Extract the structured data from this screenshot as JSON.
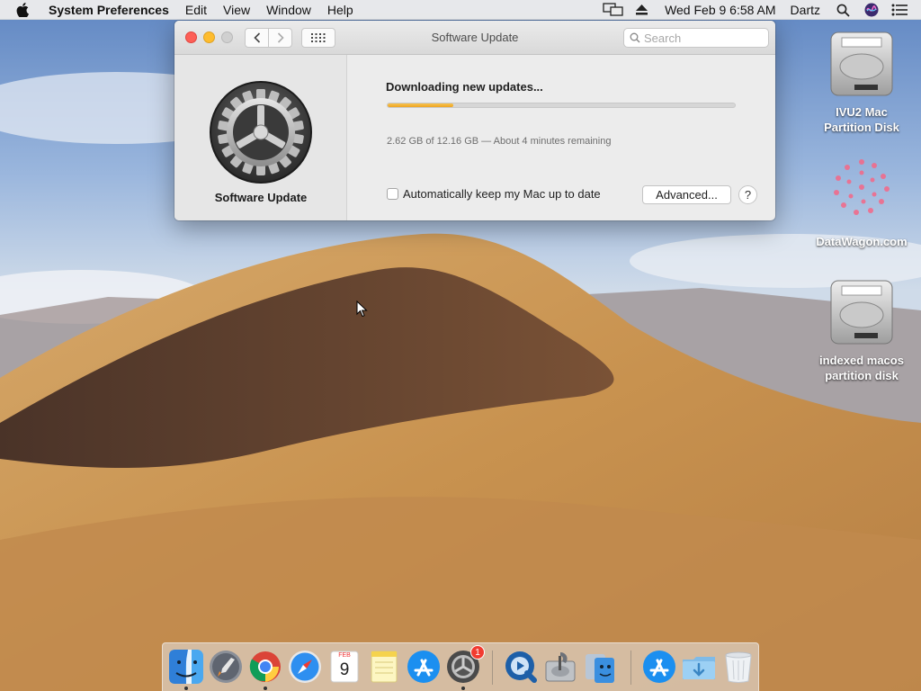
{
  "menubar": {
    "app_name": "System Preferences",
    "menus": [
      "Edit",
      "View",
      "Window",
      "Help"
    ],
    "clock": "Wed Feb 9  6:58 AM",
    "user": "Dartz"
  },
  "window": {
    "title": "Software Update",
    "search_placeholder": "Search",
    "sidebar_label": "Software Update",
    "status": "Downloading new updates...",
    "progress": 0.19,
    "progress_text": "2.62 GB of 12.16 GB — About 4 minutes remaining",
    "auto_update_label": "Automatically keep my Mac up to date",
    "auto_update_checked": false,
    "advanced_label": "Advanced...",
    "help_label": "?"
  },
  "desktop_icons": [
    {
      "label": "IVU2 Mac\nPartition Disk",
      "icon": "hard-disk-icon"
    },
    {
      "label": "DataWagon.com",
      "icon": "datawagon-logo-icon"
    },
    {
      "label": "indexed macos\npartition disk",
      "icon": "hard-disk-icon"
    }
  ],
  "dock": {
    "items": [
      {
        "name": "finder",
        "icon": "finder-icon",
        "running": true
      },
      {
        "name": "launchpad",
        "icon": "launchpad-icon",
        "running": false
      },
      {
        "name": "chrome",
        "icon": "chrome-icon",
        "running": true
      },
      {
        "name": "safari",
        "icon": "safari-icon",
        "running": false
      },
      {
        "name": "calendar",
        "icon": "calendar-icon",
        "running": false
      },
      {
        "name": "notes",
        "icon": "notes-icon",
        "running": false
      },
      {
        "name": "app-store",
        "icon": "app-store-icon",
        "running": false
      },
      {
        "name": "system-preferences",
        "icon": "system-preferences-icon",
        "running": true,
        "badge": "1"
      },
      {
        "name": "quicktime",
        "icon": "quicktime-icon",
        "running": false
      },
      {
        "name": "disk-utility",
        "icon": "disk-utility-icon",
        "running": false
      },
      {
        "name": "migration-assistant",
        "icon": "migration-assistant-icon",
        "running": false
      },
      {
        "name": "app-store-folder",
        "icon": "app-store-icon",
        "running": false
      },
      {
        "name": "downloads",
        "icon": "downloads-folder-icon",
        "running": false
      },
      {
        "name": "trash",
        "icon": "trash-icon",
        "running": false
      }
    ],
    "calendar": {
      "month": "FEB",
      "day": "9"
    }
  },
  "colors": {
    "progress_fill": "#eda422",
    "close": "#fd5f57",
    "minimize": "#febc2e"
  }
}
